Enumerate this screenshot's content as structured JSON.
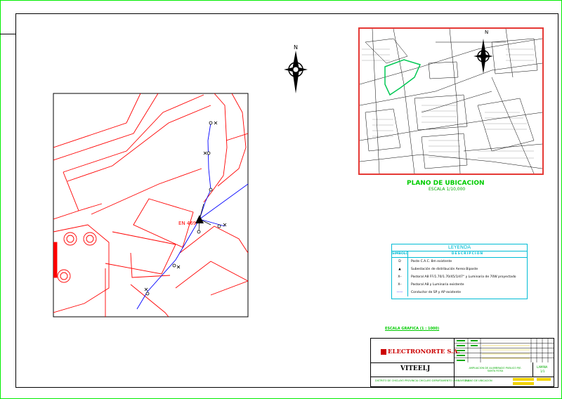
{
  "colors": {
    "sheet_border": "#00ee00",
    "frame": "#000000",
    "lines": "#ff0000",
    "network": "#0000ff",
    "legend": "#00bcd4",
    "title_text": "#00cc00",
    "logo": "#cc0000"
  },
  "main_map": {
    "substation_label": "EN 469"
  },
  "north_arrow": {
    "label": "N"
  },
  "location_map": {
    "north_label": "N",
    "title": "PLANO DE UBICACION",
    "scale": "ESCALA 1/10,000"
  },
  "legend": {
    "title": "LEYENDA",
    "header_symbol": "SIMBOLO",
    "header_description": "DESCRIPCION",
    "rows": [
      {
        "symbol": "D",
        "text": "Poste C.A.C. 8m existente"
      },
      {
        "symbol": "▲",
        "text": "Subestación de distribución Aerea Biposte"
      },
      {
        "symbol": "X–",
        "text": "Pastoral A8 FF/1.70/1.70/45/1/47° y Luminaria de 70W proyectado"
      },
      {
        "symbol": "X–",
        "text": "Pastoral A8 y Luminaria existente"
      },
      {
        "symbol": "——",
        "text": "Conductor de SP y AP existente"
      }
    ]
  },
  "scale_note": "ESCALA GRAFICA (1 : 1000)",
  "title_block": {
    "company": "ELECTRONORTE S.A.",
    "logo_text": "VITEELJ",
    "project": "AMPLIACION DE ALUMBRADO PUBLICO PJE. SANTA ROSA",
    "location": "DISTRITO DE CHICLAYO PROVINCIA CHICLAYO DEPARTAMENTO LAMBAYEQUE",
    "sheet_label": "LAMINA",
    "sheet_number": "1/1",
    "plan_name": "PLANO DE UBICACION"
  }
}
